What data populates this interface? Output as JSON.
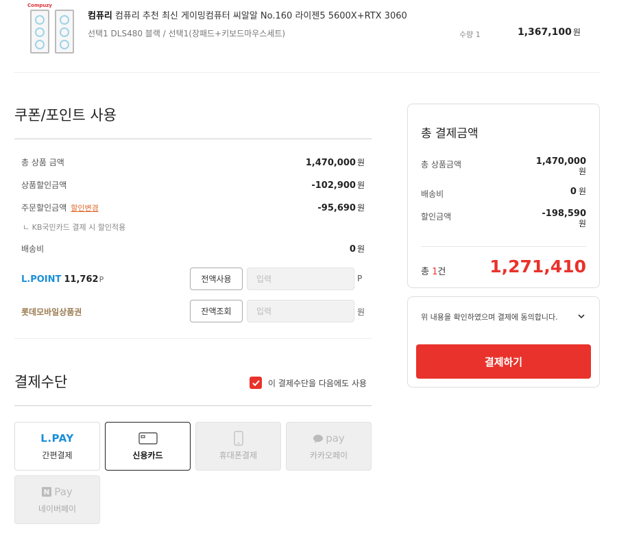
{
  "product": {
    "brand": "컴퓨리",
    "name": "컴퓨리 추천 최신 게이밍컴퓨터 씨알알 No.160 라이젠5 5600X+RTX 3060",
    "options": "선택1 DLS480 블랙 / 선택1(장패드+키보드마우스세트)",
    "quantity_label": "수량 1",
    "price": "1,367,100",
    "price_unit": "원",
    "thumb_brand": "Compuzy"
  },
  "coupon": {
    "heading": "쿠폰/포인트 사용",
    "rows": [
      {
        "label": "총 상품 금액",
        "value": "1,470,000",
        "unit": "원"
      },
      {
        "label": "상품할인금액",
        "value": "-102,900",
        "unit": "원"
      },
      {
        "label": "주문할인금액",
        "link": "할인변경",
        "value": "-95,690",
        "unit": "원",
        "note": "ㄴ KB국민카드 결제 시 할인적용"
      },
      {
        "label": "배송비",
        "value": "0",
        "unit": "원"
      }
    ],
    "lpoint": {
      "label": "L.POINT",
      "points": "11,762",
      "points_unit": "P",
      "button": "전액사용",
      "placeholder": "입력",
      "unit": "P"
    },
    "gift": {
      "label": "롯데모바일상품권",
      "button": "잔액조회",
      "placeholder": "입력",
      "unit": "원"
    }
  },
  "payment": {
    "heading": "결제수단",
    "reuse_label": "이 결제수단을 다음에도 사용",
    "reuse_checked": true,
    "methods": [
      {
        "logo": "L.PAY",
        "name": "간편결제",
        "state": "normal"
      },
      {
        "logo": "card-icon",
        "name": "신용카드",
        "state": "selected"
      },
      {
        "logo": "phone-icon",
        "name": "휴대폰결제",
        "state": "disabled"
      },
      {
        "logo": "pay",
        "name": "카카오페이",
        "state": "disabled"
      },
      {
        "logo": "Pay",
        "name": "네이버페이",
        "state": "disabled"
      }
    ]
  },
  "summary": {
    "title": "총 결제금액",
    "rows": [
      {
        "label": "총 상품금액",
        "value": "1,470,000",
        "unit": "원"
      },
      {
        "label": "배송비",
        "value": "0",
        "unit": "원"
      },
      {
        "label": "할인금액",
        "value": "-198,590",
        "unit": "원"
      }
    ],
    "count_prefix": "총 ",
    "count": "1",
    "count_suffix": "건",
    "total": "1,271,410",
    "agree_text": "위 내용을 확인하였으며 결제에 동의합니다.",
    "pay_button": "결제하기"
  },
  "colors": {
    "accent": "#e8322b",
    "lpoint": "#1a8fd8",
    "gift": "#9a7b4f",
    "link": "#e0672c"
  }
}
